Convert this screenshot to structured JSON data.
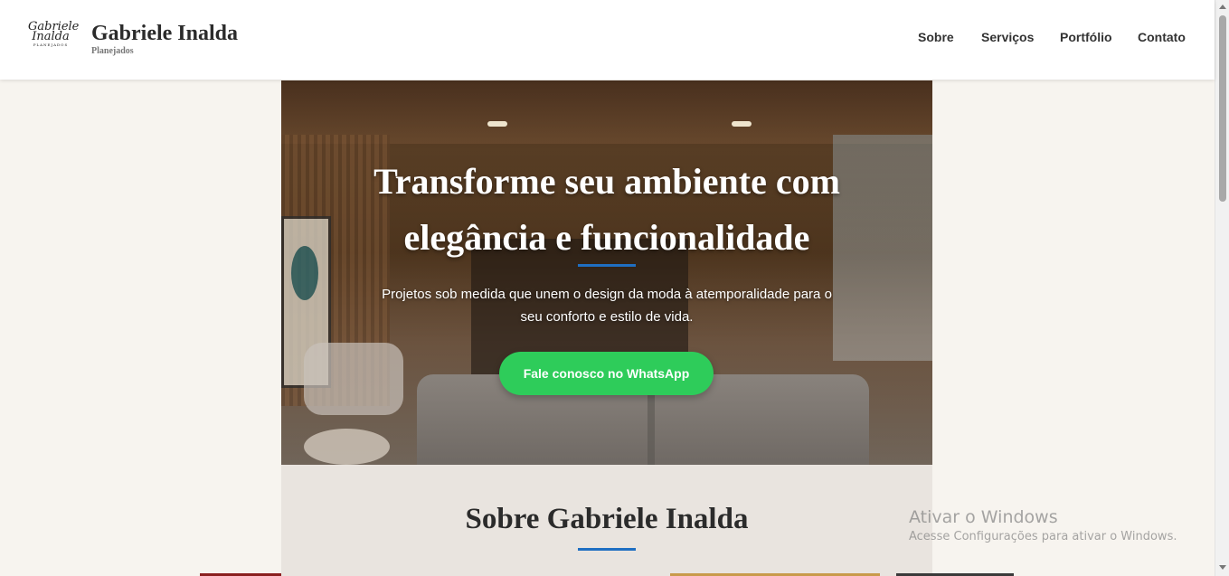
{
  "header": {
    "logo": {
      "line1": "Gabriele",
      "line2": "Inalda",
      "line3": "PLANEJADOS"
    },
    "title": "Gabriele Inalda",
    "subtitle": "Planejados",
    "nav": [
      "Sobre",
      "Serviços",
      "Portfólio",
      "Contato"
    ]
  },
  "hero": {
    "title_line1": "Transforme seu ambiente com",
    "title_line2": "elegância e funcionalidade",
    "text_line1": "Projetos sob medida que unem o design da moda à atemporalidade para o",
    "text_line2": "seu conforto e estilo de vida.",
    "cta_label": "Fale conosco no WhatsApp"
  },
  "about": {
    "title": "Sobre Gabriele Inalda"
  },
  "watermark": {
    "line1": "Ativar o Windows",
    "line2": "Acesse Configurações para ativar o Windows."
  },
  "colors": {
    "accent": "#1f6fc2",
    "whatsapp": "#2ecc5a",
    "page_bg": "#f7f4ef"
  }
}
